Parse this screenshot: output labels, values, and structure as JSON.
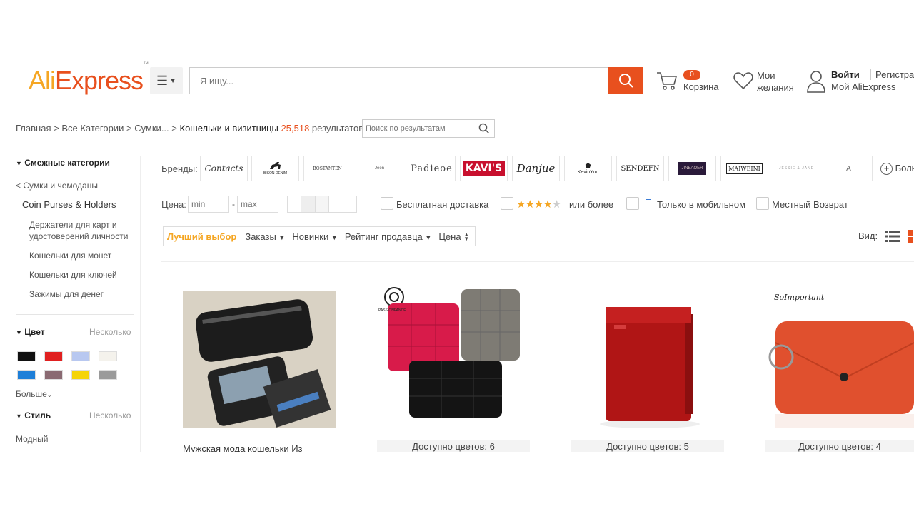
{
  "header": {
    "logo_ali": "Ali",
    "logo_express": "Express",
    "logo_tm": "™",
    "search_placeholder": "Я ищу...",
    "cart_count": "0",
    "cart_label": "Корзина",
    "wishlist_line1": "Мои",
    "wishlist_line2": "желания",
    "login": "Войти",
    "register": "Регистрация",
    "my_aliexpress": "Мой AliExpress"
  },
  "breadcrumb": {
    "home": "Главная",
    "all_categories": "Все Категории",
    "bags": "Сумки...",
    "current": "Кошельки и визитницы",
    "count": "25,518",
    "results_word": "результатов",
    "sep": ">",
    "search_placeholder": "Поиск по результатам"
  },
  "sidebar": {
    "related_title": "Смежные категории",
    "parent": "< Сумки и чемоданы",
    "current": "Coin Purses & Holders",
    "subs": [
      "Держатели для карт и удостоверений личности",
      "Кошельки для монет",
      "Кошельки для ключей",
      "Зажимы для денег"
    ],
    "color_title": "Цвет",
    "color_multi": "Несколько",
    "colors": [
      "#111111",
      "#e02020",
      "#b8c8f0",
      "#f4f2ec",
      "#1e7fd8",
      "#8a6a72",
      "#f5d40a",
      "#9a9a9a"
    ],
    "more": "Больше",
    "style_title": "Стиль",
    "style_multi": "Несколько",
    "style_first": "Модный"
  },
  "brands": {
    "label": "Бренды:",
    "items": [
      "Contacts",
      "BISON DENIM",
      "BOSTANTEN",
      "Jeen",
      "Padieoe",
      "KAVI'S",
      "Danjue",
      "KevinYun",
      "SENDEFN",
      "JINBAOER",
      "MAIWEINI",
      "JESSIE & JANE",
      "A"
    ],
    "more": "Больше"
  },
  "filters": {
    "price_label": "Цена:",
    "min_placeholder": "min",
    "max_placeholder": "max",
    "dash": "-",
    "free_shipping": "Бесплатная доставка",
    "rating_more": "или более",
    "rating_stars": 4,
    "mobile_only": "Только в мобильном",
    "local_return": "Местный Возврат"
  },
  "sort": {
    "best": "Лучший выбор",
    "orders": "Заказы",
    "newest": "Новинки",
    "seller_rating": "Рейтинг продавца",
    "price": "Цена",
    "view_label": "Вид:"
  },
  "products": [
    {
      "title": "Мужская мода кошельки Из",
      "color": "#1b1b1b"
    },
    {
      "colors_available": "Доступно цветов: 6",
      "brand": "PASSIONFANCE"
    },
    {
      "colors_available": "Доступно цветов: 5",
      "color": "#b01515"
    },
    {
      "colors_available": "Доступно цветов: 4",
      "brand": "SoImportant",
      "color": "#e0502e"
    }
  ]
}
